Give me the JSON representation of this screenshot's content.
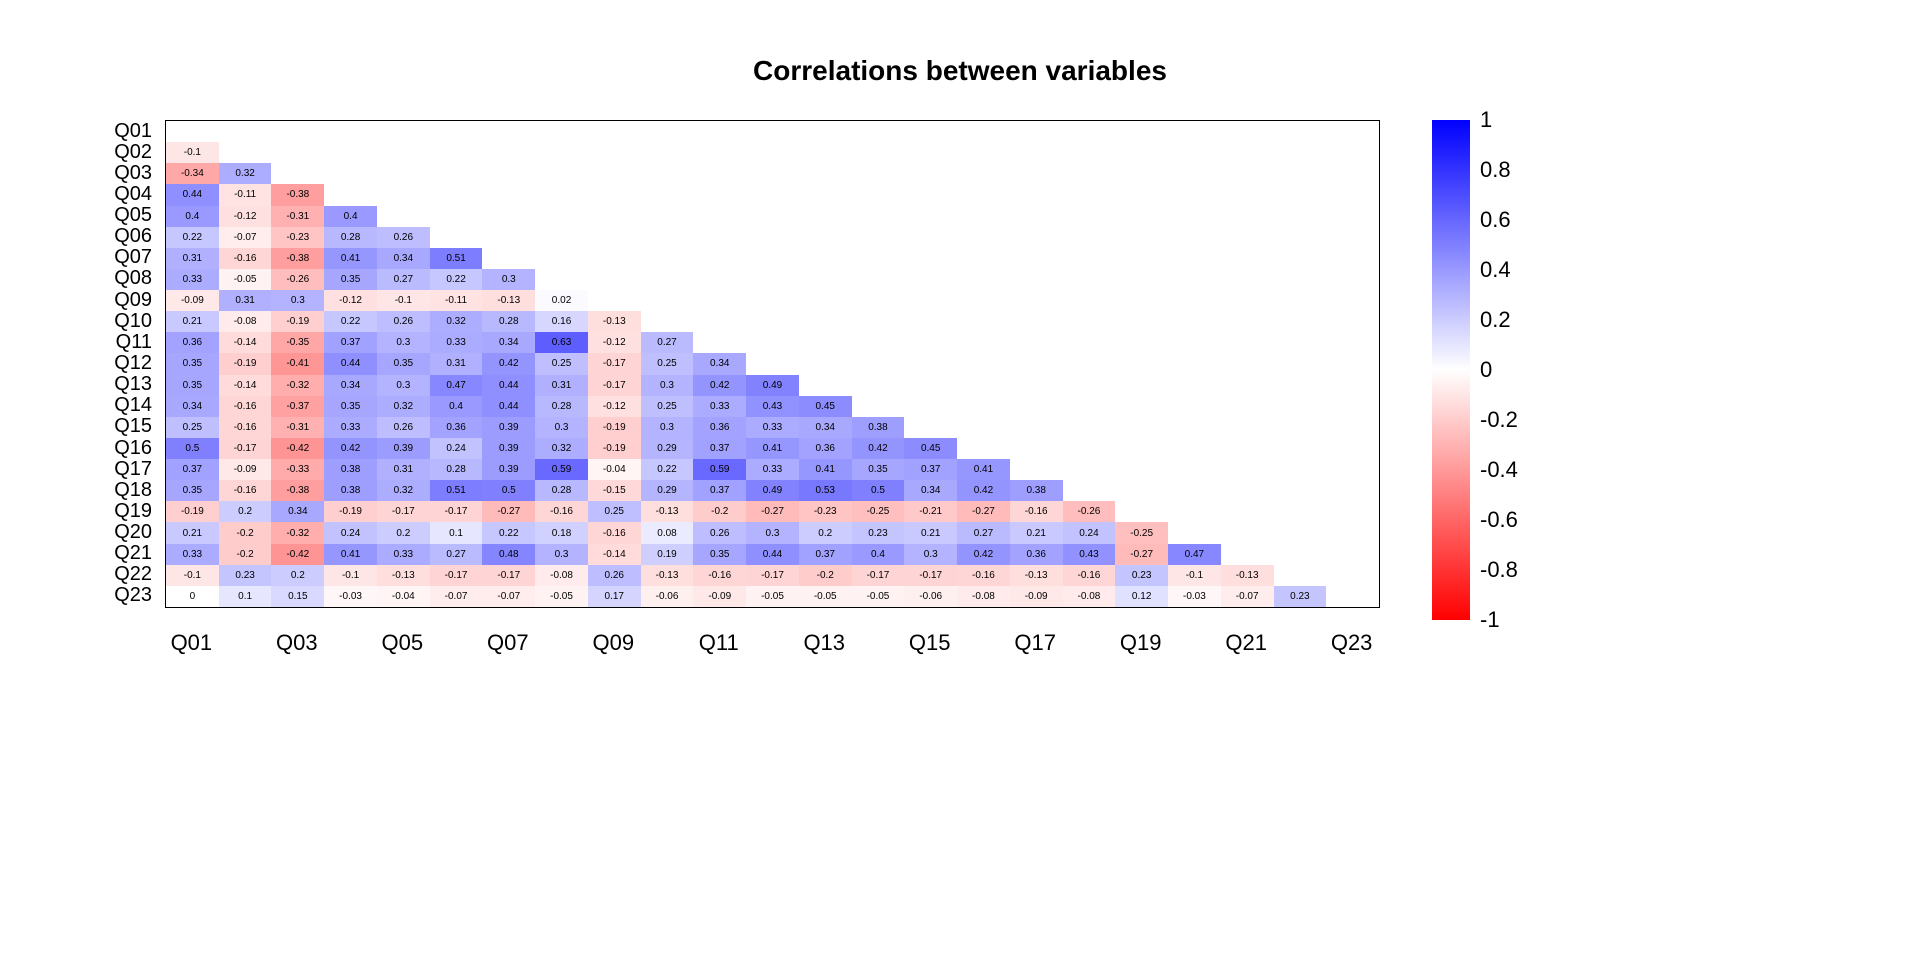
{
  "chart_data": {
    "type": "heatmap",
    "title": "Correlations between variables",
    "xlabel": "",
    "ylabel": "",
    "categories": [
      "Q01",
      "Q02",
      "Q03",
      "Q04",
      "Q05",
      "Q06",
      "Q07",
      "Q08",
      "Q09",
      "Q10",
      "Q11",
      "Q12",
      "Q13",
      "Q14",
      "Q15",
      "Q16",
      "Q17",
      "Q18",
      "Q19",
      "Q20",
      "Q21",
      "Q22",
      "Q23"
    ],
    "x_tick_labels_shown": [
      "Q01",
      "Q03",
      "Q05",
      "Q07",
      "Q09",
      "Q11",
      "Q13",
      "Q15",
      "Q17",
      "Q19",
      "Q21",
      "Q23"
    ],
    "y_labels_order_top_to_bottom": [
      "Q01",
      "Q02",
      "Q03",
      "Q04",
      "Q05",
      "Q06",
      "Q07",
      "Q08",
      "Q09",
      "Q10",
      "Q11",
      "Q12",
      "Q13",
      "Q14",
      "Q15",
      "Q16",
      "Q17",
      "Q18",
      "Q19",
      "Q20",
      "Q21",
      "Q22",
      "Q23"
    ],
    "layout": "lower-triangle-offdiagonal",
    "value_range": [
      -1,
      1
    ],
    "colorbar": {
      "ticks": [
        -1,
        -0.8,
        -0.6,
        -0.4,
        -0.2,
        0,
        0.2,
        0.4,
        0.6,
        0.8,
        1
      ],
      "colors_low_to_high": [
        "#ff0000",
        "#ffffff",
        "#0000ff"
      ]
    },
    "matrix_lower_offdiag": {
      "Q02": {
        "Q01": -0.1
      },
      "Q03": {
        "Q01": -0.34,
        "Q02": 0.32
      },
      "Q04": {
        "Q01": 0.44,
        "Q02": -0.11,
        "Q03": -0.38
      },
      "Q05": {
        "Q01": 0.4,
        "Q02": -0.12,
        "Q03": -0.31,
        "Q04": 0.4
      },
      "Q06": {
        "Q01": 0.22,
        "Q02": -0.07,
        "Q03": -0.23,
        "Q04": 0.28,
        "Q05": 0.26
      },
      "Q07": {
        "Q01": 0.31,
        "Q02": -0.16,
        "Q03": -0.38,
        "Q04": 0.41,
        "Q05": 0.34,
        "Q06": 0.51
      },
      "Q08": {
        "Q01": 0.33,
        "Q02": -0.05,
        "Q03": -0.26,
        "Q04": 0.35,
        "Q05": 0.27,
        "Q06": 0.22,
        "Q07": 0.3
      },
      "Q09": {
        "Q01": -0.09,
        "Q02": 0.31,
        "Q03": 0.3,
        "Q04": -0.12,
        "Q05": -0.1,
        "Q06": -0.11,
        "Q07": -0.13,
        "Q08": 0.02
      },
      "Q10": {
        "Q01": 0.21,
        "Q02": -0.08,
        "Q03": -0.19,
        "Q04": 0.22,
        "Q05": 0.26,
        "Q06": 0.32,
        "Q07": 0.28,
        "Q08": 0.16,
        "Q09": -0.13
      },
      "Q11": {
        "Q01": 0.36,
        "Q02": -0.14,
        "Q03": -0.35,
        "Q04": 0.37,
        "Q05": 0.3,
        "Q06": 0.33,
        "Q07": 0.34,
        "Q08": 0.63,
        "Q09": -0.12,
        "Q10": 0.27
      },
      "Q12": {
        "Q01": 0.35,
        "Q02": -0.19,
        "Q03": -0.41,
        "Q04": 0.44,
        "Q05": 0.35,
        "Q06": 0.31,
        "Q07": 0.42,
        "Q08": 0.25,
        "Q09": -0.17,
        "Q10": 0.25,
        "Q11": 0.34
      },
      "Q13": {
        "Q01": 0.35,
        "Q02": -0.14,
        "Q03": -0.32,
        "Q04": 0.34,
        "Q05": 0.3,
        "Q06": 0.47,
        "Q07": 0.44,
        "Q08": 0.31,
        "Q09": -0.17,
        "Q10": 0.3,
        "Q11": 0.42,
        "Q12": 0.49
      },
      "Q14": {
        "Q01": 0.34,
        "Q02": -0.16,
        "Q03": -0.37,
        "Q04": 0.35,
        "Q05": 0.32,
        "Q06": 0.4,
        "Q07": 0.44,
        "Q08": 0.28,
        "Q09": -0.12,
        "Q10": 0.25,
        "Q11": 0.33,
        "Q12": 0.43,
        "Q13": 0.45
      },
      "Q15": {
        "Q01": 0.25,
        "Q02": -0.16,
        "Q03": -0.31,
        "Q04": 0.33,
        "Q05": 0.26,
        "Q06": 0.36,
        "Q07": 0.39,
        "Q08": 0.3,
        "Q09": -0.19,
        "Q10": 0.3,
        "Q11": 0.36,
        "Q12": 0.33,
        "Q13": 0.34,
        "Q14": 0.38
      },
      "Q16": {
        "Q01": 0.5,
        "Q02": -0.17,
        "Q03": -0.42,
        "Q04": 0.42,
        "Q05": 0.39,
        "Q06": 0.24,
        "Q07": 0.39,
        "Q08": 0.32,
        "Q09": -0.19,
        "Q10": 0.29,
        "Q11": 0.37,
        "Q12": 0.41,
        "Q13": 0.36,
        "Q14": 0.42,
        "Q15": 0.45
      },
      "Q17": {
        "Q01": 0.37,
        "Q02": -0.09,
        "Q03": -0.33,
        "Q04": 0.38,
        "Q05": 0.31,
        "Q06": 0.28,
        "Q07": 0.39,
        "Q08": 0.59,
        "Q09": -0.04,
        "Q10": 0.22,
        "Q11": 0.59,
        "Q12": 0.33,
        "Q13": 0.41,
        "Q14": 0.35,
        "Q15": 0.37,
        "Q16": 0.41
      },
      "Q18": {
        "Q01": 0.35,
        "Q02": -0.16,
        "Q03": -0.38,
        "Q04": 0.38,
        "Q05": 0.32,
        "Q06": 0.51,
        "Q07": 0.5,
        "Q08": 0.28,
        "Q09": -0.15,
        "Q10": 0.29,
        "Q11": 0.37,
        "Q12": 0.49,
        "Q13": 0.53,
        "Q14": 0.5,
        "Q15": 0.34,
        "Q16": 0.42,
        "Q17": 0.38
      },
      "Q19": {
        "Q01": -0.19,
        "Q02": 0.2,
        "Q03": 0.34,
        "Q04": -0.19,
        "Q05": -0.17,
        "Q06": -0.17,
        "Q07": -0.27,
        "Q08": -0.16,
        "Q09": 0.25,
        "Q10": -0.13,
        "Q11": -0.2,
        "Q12": -0.27,
        "Q13": -0.23,
        "Q14": -0.25,
        "Q15": -0.21,
        "Q16": -0.27,
        "Q17": -0.16,
        "Q18": -0.26
      },
      "Q20": {
        "Q01": 0.21,
        "Q02": -0.2,
        "Q03": -0.32,
        "Q04": 0.24,
        "Q05": 0.2,
        "Q06": 0.1,
        "Q07": 0.22,
        "Q08": 0.18,
        "Q09": -0.16,
        "Q10": 0.08,
        "Q11": 0.26,
        "Q12": 0.3,
        "Q13": 0.2,
        "Q14": 0.23,
        "Q15": 0.21,
        "Q16": 0.27,
        "Q17": 0.21,
        "Q18": 0.24,
        "Q19": -0.25
      },
      "Q21": {
        "Q01": 0.33,
        "Q02": -0.2,
        "Q03": -0.42,
        "Q04": 0.41,
        "Q05": 0.33,
        "Q06": 0.27,
        "Q07": 0.48,
        "Q08": 0.3,
        "Q09": -0.14,
        "Q10": 0.19,
        "Q11": 0.35,
        "Q12": 0.44,
        "Q13": 0.37,
        "Q14": 0.4,
        "Q15": 0.3,
        "Q16": 0.42,
        "Q17": 0.36,
        "Q18": 0.43,
        "Q19": -0.27,
        "Q20": 0.47
      },
      "Q22": {
        "Q01": -0.1,
        "Q02": 0.23,
        "Q03": 0.2,
        "Q04": -0.1,
        "Q05": -0.13,
        "Q06": -0.17,
        "Q07": -0.17,
        "Q08": -0.08,
        "Q09": 0.26,
        "Q10": -0.13,
        "Q11": -0.16,
        "Q12": -0.17,
        "Q13": -0.2,
        "Q14": -0.17,
        "Q15": -0.17,
        "Q16": -0.16,
        "Q17": -0.13,
        "Q18": -0.16,
        "Q19": 0.23,
        "Q20": -0.1,
        "Q21": -0.13
      },
      "Q23": {
        "Q01": 0,
        "Q02": 0.1,
        "Q03": 0.15,
        "Q04": -0.03,
        "Q05": -0.04,
        "Q06": -0.07,
        "Q07": -0.07,
        "Q08": -0.05,
        "Q09": 0.17,
        "Q10": -0.06,
        "Q11": -0.09,
        "Q12": -0.05,
        "Q13": -0.05,
        "Q14": -0.05,
        "Q15": -0.06,
        "Q16": -0.08,
        "Q17": -0.09,
        "Q18": -0.08,
        "Q19": 0.12,
        "Q20": -0.03,
        "Q21": -0.07,
        "Q22": 0.23
      }
    }
  }
}
